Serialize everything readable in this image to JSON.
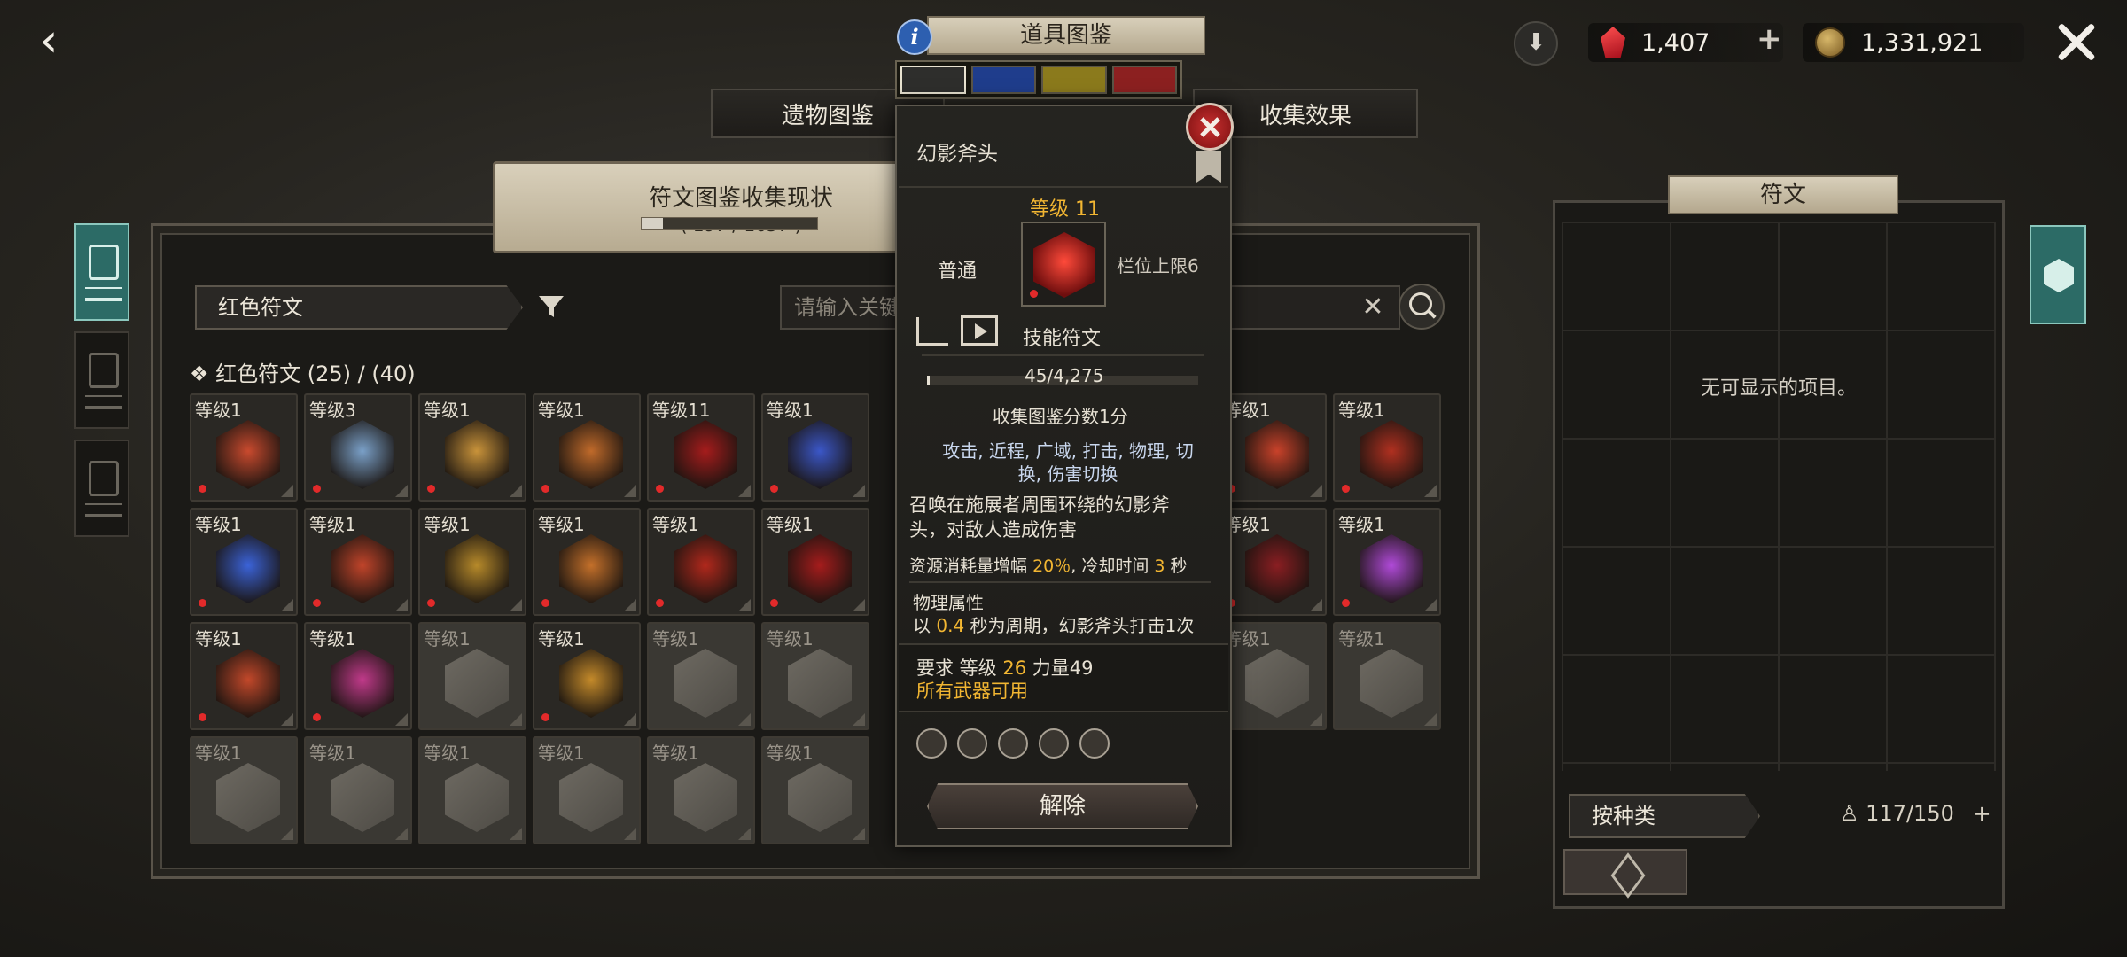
{
  "topbar": {
    "gems": "1,407",
    "gold": "1,331,921",
    "plus": "+"
  },
  "tabs": {
    "relics": "遗物图鉴",
    "collection_effects": "收集效果",
    "codex_title": "道具图鉴",
    "info": "i"
  },
  "color_tabs": [
    "#2e2e2c",
    "#1f3d8c",
    "#8b7a1c",
    "#8c2020"
  ],
  "banner": {
    "title": "符文图鉴收集现状",
    "count": "( 197 / 1657 )",
    "progress": 0.119
  },
  "filter": {
    "selected": "红色符文",
    "search_placeholder": "请输入关键"
  },
  "section": {
    "title": "红色符文 (25) / (40)"
  },
  "grid_levels": [
    "等级1",
    "等级3",
    "等级1",
    "等级1",
    "等级11",
    "等级1",
    "",
    "",
    "",
    "等级1",
    "等级1",
    "等级1",
    "等级1",
    "等级1",
    "等级1",
    "等级1",
    "等级1",
    "",
    "",
    "",
    "等级1",
    "等级1",
    "等级1",
    "等级1",
    "等级1",
    "等级1",
    "等级1",
    "等级1",
    "",
    "",
    "",
    "等级1",
    "等级1",
    "等级1",
    "等级1",
    "等级1",
    "等级1",
    "等级1",
    "等级1",
    "",
    "",
    "",
    "",
    ""
  ],
  "tooltip": {
    "name": "幻影斧头",
    "level": "等级 11",
    "grade": "普通",
    "slot_limit": "栏位上限6",
    "type": "技能符文",
    "xp": "45/4,275",
    "xp_progress": 0.0105,
    "score": "收集图鉴分数1分",
    "tags_line1": "攻击, 近程, 广域, 打击, 物理, 切",
    "tags_line2": "换, 伤害切换",
    "desc_line1": "召唤在施展者周围环绕的幻影斧",
    "desc_line2": "头，对敌人造成伤害",
    "cost_prefix": "资源消耗量增幅",
    "cost_value": "20％",
    "cost_mid": ", 冷却时间",
    "cost_cd": "3",
    "cost_unit": "秒",
    "attr_title": "物理属性",
    "attr_prefix": "以",
    "attr_value": "0.4",
    "attr_suffix": "秒为周期，幻影斧头打击1次",
    "req_prefix": "要求 等级",
    "req_level": "26",
    "req_str": "力量49",
    "req_weapon": "所有武器可用",
    "release": "解除"
  },
  "right": {
    "title": "符文",
    "empty": "无可显示的项目。",
    "sort": "按种类",
    "capacity": "117/150",
    "plus": "+"
  }
}
